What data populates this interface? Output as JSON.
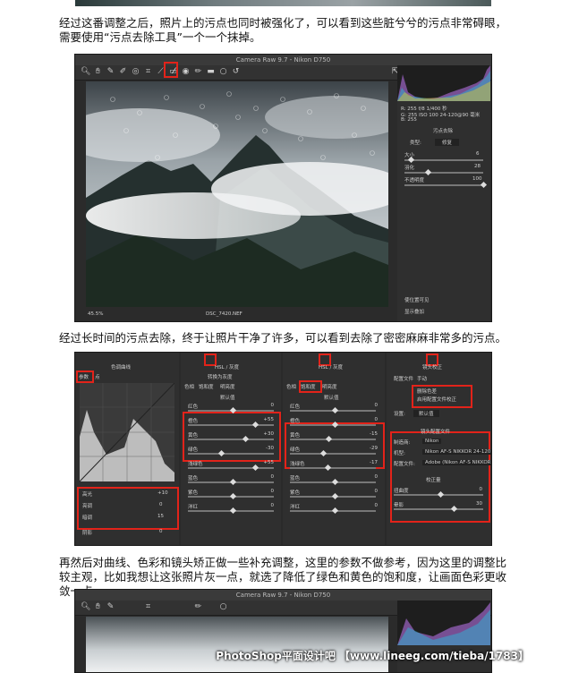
{
  "para1": "经过这番调整之后，照片上的污点也同时被强化了，可以看到这些脏兮兮的污点非常碍眼，需要使用“污点去除工具”一个一个抹掉。",
  "para2": "经过长时间的污点去除，终于让照片干净了许多，可以看到去除了密密麻麻非常多的污点。",
  "para3": "再然后对曲线、色彩和镜头矫正做一些补充调整，这里的参数不做参考，因为这里的调整比较主观，比如我想让这张照片灰一点，就选了降低了绿色和黄色的饱和度，让画面色彩更收敛一点。",
  "window1": {
    "title": "Camera Raw 9.7 - Nikon D750",
    "zoom": "45.5%",
    "filename": "DSC_7420.NEF",
    "histogram_info": [
      "R: 255  f/8  1/400 秒",
      "G: 255  ISO 100  24-120@90 毫米",
      "B: 255"
    ],
    "panel_title": "污点去除",
    "type_label": "类型:",
    "type_value": "修复",
    "sliders": [
      {
        "label": "大小",
        "value": "6"
      },
      {
        "label": "羽化",
        "value": "28"
      },
      {
        "label": "不透明度",
        "value": "100"
      }
    ],
    "checkbox1": "使位置可见",
    "checkbox2": "显示叠加"
  },
  "window2": {
    "tabs": [
      "色调曲线",
      "HSL / 灰度",
      "分离色调",
      "镜头校正"
    ],
    "curve": {
      "subtabs": [
        "参数",
        "点"
      ],
      "sliders": [
        {
          "label": "高光",
          "value": "+10"
        },
        {
          "label": "亮调",
          "value": "0"
        },
        {
          "label": "暗调",
          "value": "15"
        },
        {
          "label": "阴影",
          "value": "0"
        }
      ]
    },
    "hsl": {
      "subtabs": [
        "色相",
        "饱和度",
        "明亮度"
      ],
      "checkbox": "转换为灰度",
      "section": "默认值",
      "rows": [
        {
          "label": "红色",
          "value": "0"
        },
        {
          "label": "橙色",
          "value": "+55"
        },
        {
          "label": "黄色",
          "value": "+30"
        },
        {
          "label": "绿色",
          "value": "-30"
        },
        {
          "label": "浅绿色",
          "value": "+55"
        },
        {
          "label": "蓝色",
          "value": "0"
        },
        {
          "label": "紫色",
          "value": "0"
        },
        {
          "label": "洋红",
          "value": "0"
        }
      ]
    },
    "sat": {
      "section": "默认值",
      "rows": [
        {
          "label": "红色",
          "value": "0"
        },
        {
          "label": "橙色",
          "value": "0"
        },
        {
          "label": "黄色",
          "value": "-15"
        },
        {
          "label": "绿色",
          "value": "-29"
        },
        {
          "label": "浅绿色",
          "value": "-17"
        },
        {
          "label": "蓝色",
          "value": "0"
        },
        {
          "label": "紫色",
          "value": "0"
        },
        {
          "label": "洋红",
          "value": "0"
        }
      ]
    },
    "lens": {
      "subtabs": [
        "配置文件",
        "手动"
      ],
      "checks": [
        "删除色差",
        "启用配置文件校正"
      ],
      "setup_label": "设置:",
      "setup_value": "默认值",
      "profile_title": "镜头配置文件",
      "profile_rows": [
        {
          "label": "制造商:",
          "value": "Nikon"
        },
        {
          "label": "机型:",
          "value": "Nikon AF-S NIKKOR 24-120..."
        },
        {
          "label": "配置文件:",
          "value": "Adobe (Nikon AF-S NIKKOR 2..."
        }
      ],
      "amount_title": "校正量",
      "amount_rows": [
        {
          "label": "扭曲度",
          "value": "0"
        },
        {
          "label": "晕影",
          "value": "30"
        }
      ]
    }
  },
  "window3": {
    "title": "Camera Raw 9.7 - Nikon D750"
  },
  "watermark": "PhotoShop平面设计吧 【www.lineeg.com/tieba/1783】",
  "colors": {
    "redbox": "#e2231a",
    "panel": "#2f2f2f",
    "window": "#2b2b2b"
  }
}
